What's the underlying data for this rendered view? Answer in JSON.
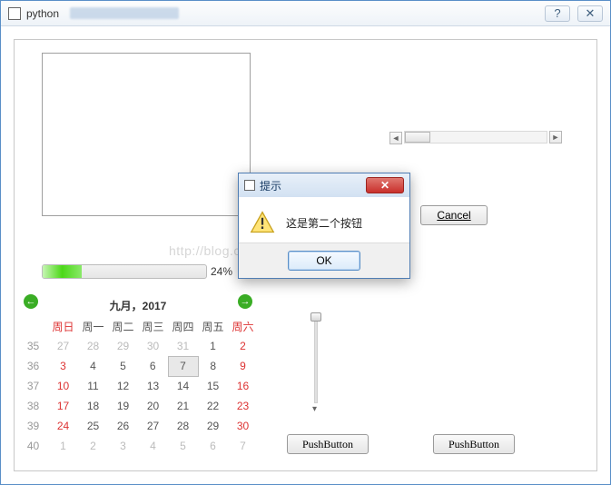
{
  "window": {
    "title": "python",
    "help": "?",
    "close": "✕"
  },
  "scrollbar": {
    "left": "◄",
    "right": "►"
  },
  "cancel": "Cancel",
  "progress": {
    "percent": 24,
    "label": "24%"
  },
  "watermark": "http://blog.csdn.net/gucunlin",
  "calendar": {
    "prev": "←",
    "next": "→",
    "header": "九月，2017",
    "weekHeader": "",
    "days": [
      "周日",
      "周一",
      "周二",
      "周三",
      "周四",
      "周五",
      "周六"
    ],
    "rows": [
      {
        "wk": "35",
        "cells": [
          {
            "v": "27",
            "g": 1
          },
          {
            "v": "28",
            "g": 1
          },
          {
            "v": "29",
            "g": 1
          },
          {
            "v": "30",
            "g": 1
          },
          {
            "v": "31",
            "g": 1
          },
          {
            "v": "1"
          },
          {
            "v": "2",
            "we": 1
          }
        ]
      },
      {
        "wk": "36",
        "cells": [
          {
            "v": "3",
            "we": 1
          },
          {
            "v": "4"
          },
          {
            "v": "5"
          },
          {
            "v": "6"
          },
          {
            "v": "7",
            "today": 1
          },
          {
            "v": "8"
          },
          {
            "v": "9",
            "we": 1
          }
        ]
      },
      {
        "wk": "37",
        "cells": [
          {
            "v": "10",
            "we": 1
          },
          {
            "v": "11"
          },
          {
            "v": "12"
          },
          {
            "v": "13"
          },
          {
            "v": "14"
          },
          {
            "v": "15"
          },
          {
            "v": "16",
            "we": 1
          }
        ]
      },
      {
        "wk": "38",
        "cells": [
          {
            "v": "17",
            "we": 1
          },
          {
            "v": "18"
          },
          {
            "v": "19"
          },
          {
            "v": "20"
          },
          {
            "v": "21"
          },
          {
            "v": "22"
          },
          {
            "v": "23",
            "we": 1
          }
        ]
      },
      {
        "wk": "39",
        "cells": [
          {
            "v": "24",
            "we": 1
          },
          {
            "v": "25"
          },
          {
            "v": "26"
          },
          {
            "v": "27"
          },
          {
            "v": "28"
          },
          {
            "v": "29"
          },
          {
            "v": "30",
            "we": 1
          }
        ]
      },
      {
        "wk": "40",
        "cells": [
          {
            "v": "1",
            "g": 1
          },
          {
            "v": "2",
            "g": 1
          },
          {
            "v": "3",
            "g": 1
          },
          {
            "v": "4",
            "g": 1
          },
          {
            "v": "5",
            "g": 1
          },
          {
            "v": "6",
            "g": 1
          },
          {
            "v": "7",
            "g": 1
          }
        ]
      }
    ]
  },
  "push": "PushButton",
  "dialog": {
    "title": "提示",
    "message": "这是第二个按钮",
    "ok": "OK",
    "close": "✕"
  },
  "slider_arrow": "▾"
}
